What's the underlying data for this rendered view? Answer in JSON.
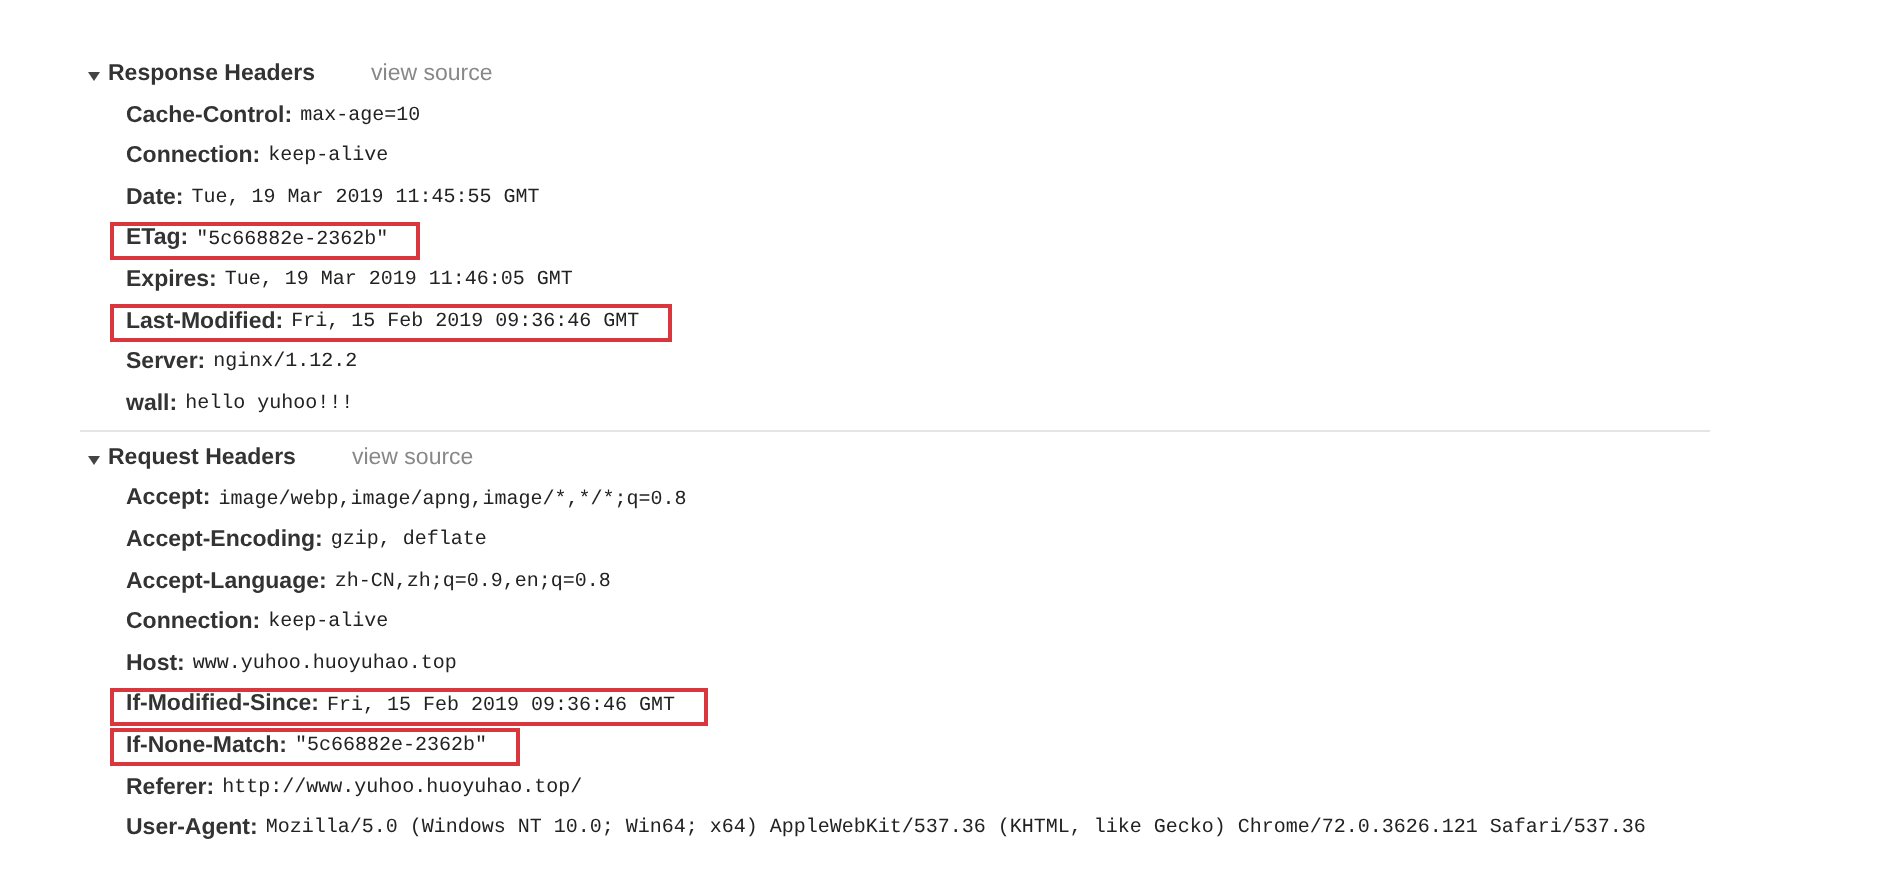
{
  "sections": [
    {
      "title": "Response Headers",
      "link": "view source",
      "expanded": true,
      "headers": [
        {
          "name": "Cache-Control:",
          "value": "max-age=10",
          "highlighted": false
        },
        {
          "name": "Connection:",
          "value": "keep-alive",
          "highlighted": false
        },
        {
          "name": "Date:",
          "value": "Tue, 19 Mar 2019 11:45:55 GMT",
          "highlighted": false
        },
        {
          "name": "ETag:",
          "value": "\"5c66882e-2362b\"",
          "highlighted": true
        },
        {
          "name": "Expires:",
          "value": "Tue, 19 Mar 2019 11:46:05 GMT",
          "highlighted": false
        },
        {
          "name": "Last-Modified:",
          "value": "Fri, 15 Feb 2019 09:36:46 GMT",
          "highlighted": true
        },
        {
          "name": "Server:",
          "value": "nginx/1.12.2",
          "highlighted": false
        },
        {
          "name": "wall:",
          "value": "hello yuhoo!!!",
          "highlighted": false
        }
      ]
    },
    {
      "title": "Request Headers",
      "link": "view source",
      "expanded": true,
      "headers": [
        {
          "name": "Accept:",
          "value": "image/webp,image/apng,image/*,*/*;q=0.8",
          "highlighted": false
        },
        {
          "name": "Accept-Encoding:",
          "value": "gzip, deflate",
          "highlighted": false
        },
        {
          "name": "Accept-Language:",
          "value": "zh-CN,zh;q=0.9,en;q=0.8",
          "highlighted": false
        },
        {
          "name": "Connection:",
          "value": "keep-alive",
          "highlighted": false
        },
        {
          "name": "Host:",
          "value": "www.yuhoo.huoyuhao.top",
          "highlighted": false
        },
        {
          "name": "If-Modified-Since:",
          "value": "Fri, 15 Feb 2019 09:36:46 GMT",
          "highlighted": true
        },
        {
          "name": "If-None-Match:",
          "value": "\"5c66882e-2362b\"",
          "highlighted": true
        },
        {
          "name": "Referer:",
          "value": "http://www.yuhoo.huoyuhao.top/",
          "highlighted": false
        },
        {
          "name": "User-Agent:",
          "value": "Mozilla/5.0 (Windows NT 10.0; Win64; x64) AppleWebKit/537.36 (KHTML, like Gecko) Chrome/72.0.3626.121 Safari/537.36",
          "highlighted": false
        }
      ]
    }
  ]
}
